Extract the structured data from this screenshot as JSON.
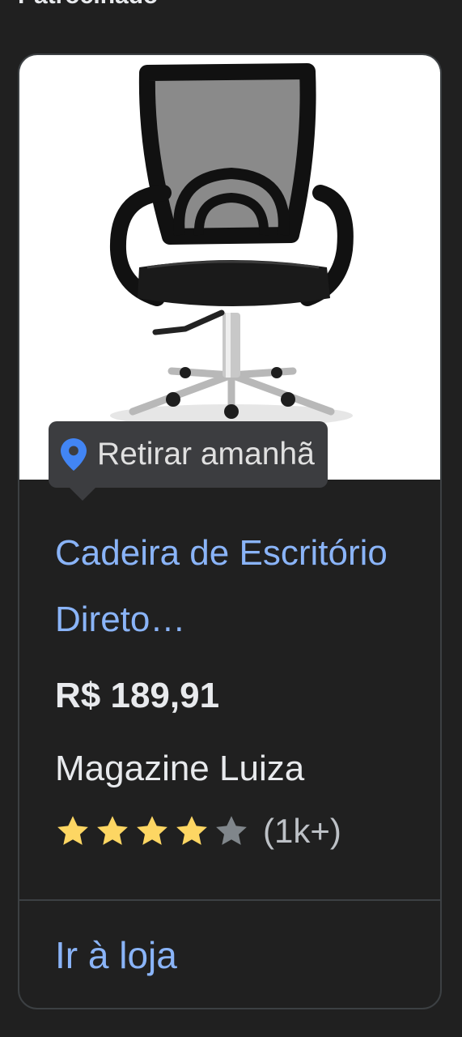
{
  "section": {
    "heading": "Patrocinado"
  },
  "product": {
    "pickup_label": "Retirar amanhã",
    "title": "Cadeira de Escritório Direto…",
    "price": "R$ 189,91",
    "merchant": "Magazine Luiza",
    "rating": {
      "stars": 4,
      "max": 5,
      "count_label": "(1k+)"
    },
    "store_link": "Ir à loja",
    "image_icon": "office-chair-image"
  },
  "colors": {
    "link": "#8ab4f8",
    "star_filled": "#fdd663",
    "star_empty": "#80868b",
    "pin": "#4285f4"
  }
}
